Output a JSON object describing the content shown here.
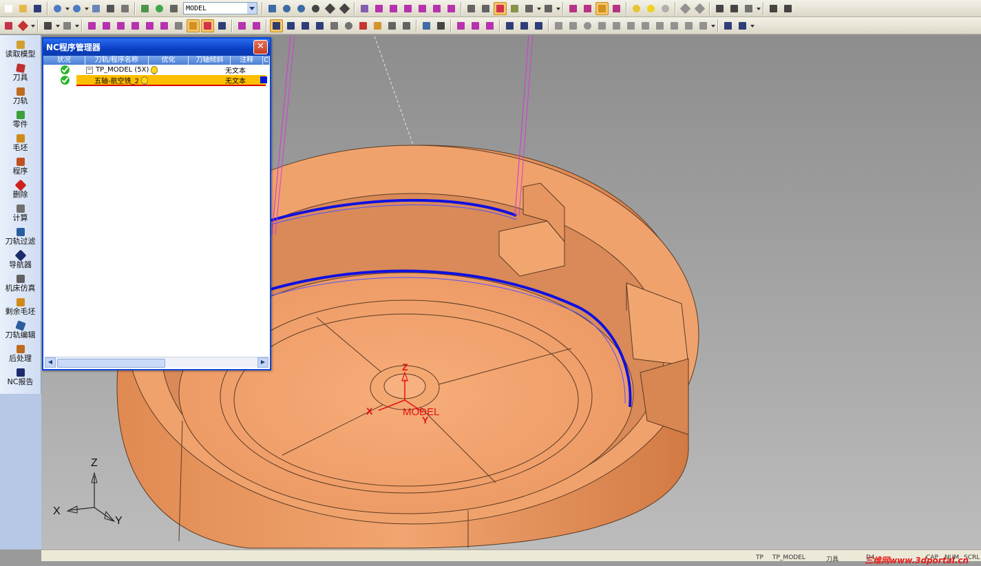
{
  "toolbar": {
    "model_combo_value": "MODEL"
  },
  "sidebar": {
    "items": [
      {
        "label": "读取模型",
        "icon": "read-model-icon"
      },
      {
        "label": "刀具",
        "icon": "tool-icon"
      },
      {
        "label": "刀轨",
        "icon": "toolpath-icon"
      },
      {
        "label": "零件",
        "icon": "part-icon"
      },
      {
        "label": "毛坯",
        "icon": "stock-icon"
      },
      {
        "label": "程序",
        "icon": "program-icon"
      },
      {
        "label": "删除",
        "icon": "delete-icon"
      },
      {
        "label": "计算",
        "icon": "calculate-icon"
      },
      {
        "label": "刀轨过滤",
        "icon": "toolpath-filter-icon"
      },
      {
        "label": "导航器",
        "icon": "navigator-icon"
      },
      {
        "label": "机床仿真",
        "icon": "machine-simulation-icon"
      },
      {
        "label": "剩余毛坯",
        "icon": "remaining-stock-icon"
      },
      {
        "label": "刀轨编辑",
        "icon": "toolpath-edit-icon"
      },
      {
        "label": "后处理",
        "icon": "post-process-icon"
      },
      {
        "label": "NC报告",
        "icon": "nc-report-icon"
      }
    ]
  },
  "nc_manager": {
    "title": "NC程序管理器",
    "close_label": "✕",
    "columns": [
      "状况",
      "刀轨/程序名称",
      "优化",
      "刀轴倾斜",
      "注释",
      "C"
    ],
    "rows": [
      {
        "name": "TP_MODEL (5X)",
        "note": "无文本",
        "expander": "−"
      },
      {
        "name": "五轴-航空铣_2",
        "note": "无文本"
      }
    ]
  },
  "viewport": {
    "model_axis": {
      "z": "Z",
      "x": "X",
      "y": "Y",
      "label": "MODEL"
    },
    "triad": {
      "z": "Z",
      "x": "X",
      "y": "Y"
    },
    "colors": {
      "part": "#f0a06e",
      "toolpath": "#1010e0",
      "tool_axis": "#d040d0",
      "axis_red": "#e01010"
    }
  },
  "statusbar": {
    "left": "TP",
    "model": "TP_MODEL",
    "tool_label": "刀具",
    "tool_value": "D4",
    "cap": "CAP",
    "num": "NUM",
    "scrl": "SCRL",
    "watermark": "三维网www.3dportal.cn"
  }
}
